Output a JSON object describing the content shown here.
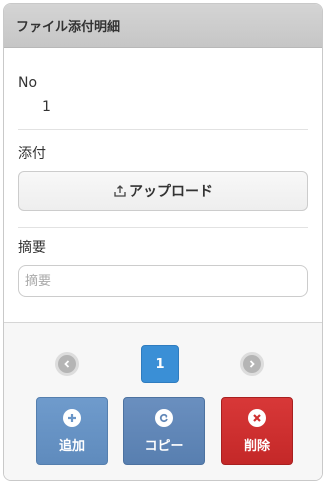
{
  "panel": {
    "title": "ファイル添付明細"
  },
  "fields": {
    "no": {
      "label": "No",
      "value": "1"
    },
    "attachment": {
      "label": "添付",
      "button_label": "アップロード",
      "icon": "upload-icon"
    },
    "summary": {
      "label": "摘要",
      "placeholder": "摘要",
      "value": ""
    }
  },
  "pager": {
    "current_page": "1",
    "prev_icon": "chevron-left-icon",
    "next_icon": "chevron-right-icon"
  },
  "actions": {
    "add": {
      "label": "追加",
      "icon": "plus-circle-icon",
      "color": "#6a96c8"
    },
    "copy": {
      "label": "コピー",
      "icon": "redo-circle-icon",
      "color": "#6288b8"
    },
    "delete": {
      "label": "削除",
      "icon": "x-circle-icon",
      "color": "#cf3030"
    }
  }
}
